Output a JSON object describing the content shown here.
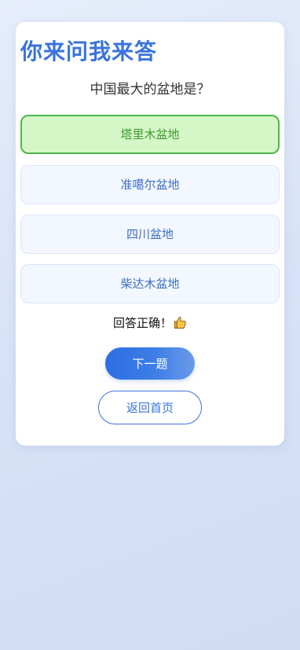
{
  "app": {
    "title": "你来问我来答"
  },
  "quiz": {
    "question": "中国最大的盆地是？",
    "options": [
      {
        "label": "塔里木盆地",
        "state": "correct"
      },
      {
        "label": "准噶尔盆地",
        "state": "default"
      },
      {
        "label": "四川盆地",
        "state": "default"
      },
      {
        "label": "柴达木盆地",
        "state": "default"
      }
    ],
    "feedback": "回答正确！",
    "feedback_icon": "thumbs-up-icon"
  },
  "actions": {
    "next_label": "下一题",
    "home_label": "返回首页"
  },
  "colors": {
    "accent": "#3a73dc",
    "correct_bg": "#d5f6c6",
    "correct_border": "#4fb54a",
    "option_bg": "#f3f7ff"
  }
}
